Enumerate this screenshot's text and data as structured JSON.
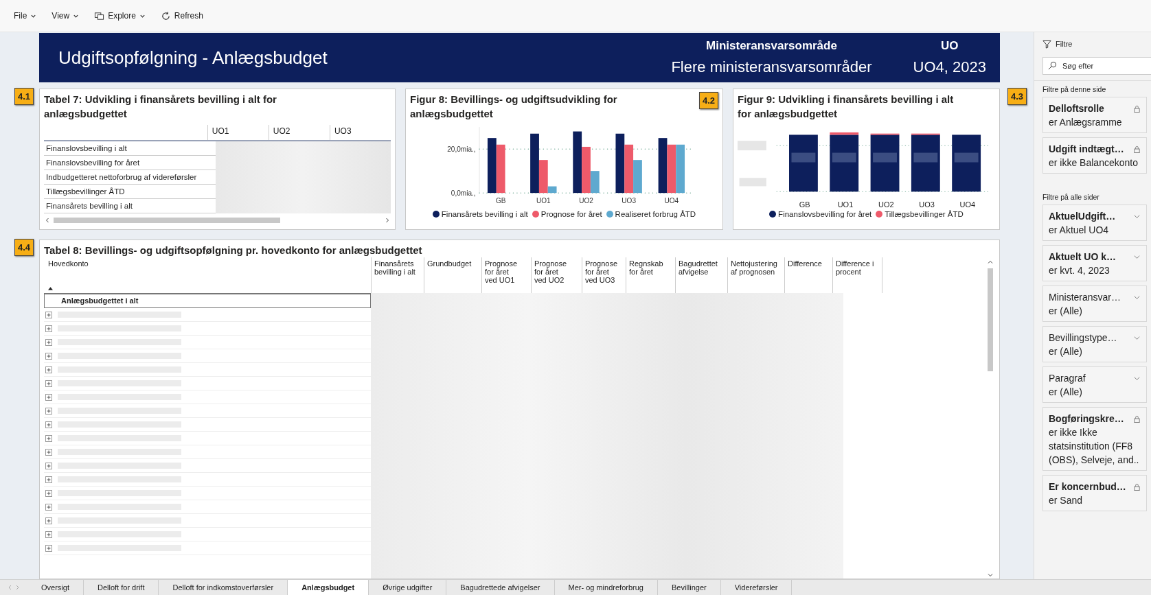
{
  "menu": [
    {
      "label": "File"
    },
    {
      "label": "View"
    },
    {
      "label": "Explore"
    },
    {
      "label": "Refresh"
    }
  ],
  "banner": {
    "title": "Udgiftsopfølgning - Anlægsbudget",
    "field_1_label": "Ministeransvarsområde",
    "field_1_value": "Flere ministeransvarsområder",
    "field_2_label": "UO",
    "field_2_value": "UO4, 2023"
  },
  "tabel7": {
    "badge": "4.1",
    "title": "Tabel 7: Udvikling i finansårets bevilling i alt for anlægsbudgettet",
    "columns": [
      "UO1",
      "UO2",
      "UO3"
    ],
    "rows": [
      "Finanslovsbevilling i alt",
      "Finanslovsbevilling for året",
      "Indbudgetteret nettoforbrug af videreførsler",
      "Tillægsbevillinger ÅTD",
      "Finansårets bevilling i alt"
    ]
  },
  "figur8": {
    "badge": "4.2",
    "title": "Figur 8: Bevillings- og udgiftsudvikling for anlægsbudgettet",
    "chart_data": {
      "type": "bar",
      "categories": [
        "GB",
        "UO1",
        "UO2",
        "UO3",
        "UO4"
      ],
      "ylim": [
        0,
        30
      ],
      "yticks": [
        {
          "value": 0,
          "label": "0,0mia.,"
        },
        {
          "value": 20,
          "label": "20,0mia.,"
        }
      ],
      "series": [
        {
          "name": "Finansårets bevilling i alt",
          "color": "#0d1f5c",
          "values": [
            25,
            27,
            28,
            27,
            25
          ]
        },
        {
          "name": "Prognose for året",
          "color": "#ee5a6a",
          "values": [
            22,
            15,
            21,
            22,
            22
          ]
        },
        {
          "name": "Realiseret forbrug ÅTD",
          "color": "#5ea9cf",
          "values": [
            null,
            3,
            10,
            15,
            22
          ]
        }
      ]
    }
  },
  "figur9": {
    "badge": "4.3",
    "title": "Figur 9: Udvikling i finansårets bevilling i alt for anlægsbudgettet",
    "categories": [
      "GB",
      "UO1",
      "UO2",
      "UO3",
      "UO4"
    ],
    "legend": [
      {
        "name": "Finanslovsbevilling for året",
        "color": "#0d1f5c"
      },
      {
        "name": "Tillægsbevillinger ÅTD",
        "color": "#ee5a6a"
      }
    ]
  },
  "tabel8": {
    "badge": "4.4",
    "title": "Tabel 8: Bevillings- og udgiftsopfølgning pr. hovedkonto for anlægsbudgettet",
    "columns": [
      "Hovedkonto",
      "Finansårets\nbevilling i alt",
      "Grundbudget",
      "Prognose\nfor året\nved UO1",
      "Prognose\nfor året\nved UO2",
      "Prognose\nfor året\nved UO3",
      "Regnskab\nfor året",
      "Bagudrettet\nafvigelse",
      "Nettojustering\naf prognosen",
      "Difference",
      "Difference i\nprocent"
    ],
    "total_row": "Anlægsbudgettet i alt",
    "rows": [
      {
        "expanded": false
      },
      {
        "expanded": false
      },
      {
        "expanded": false
      },
      {
        "expanded": false
      },
      {
        "expanded": false
      },
      {
        "expanded": false
      },
      {
        "expanded": false
      },
      {
        "expanded": false
      },
      {
        "expanded": false
      },
      {
        "expanded": false
      },
      {
        "expanded": false
      },
      {
        "expanded": false
      },
      {
        "expanded": false
      },
      {
        "expanded": false
      },
      {
        "expanded": false
      },
      {
        "expanded": false
      },
      {
        "expanded": false
      },
      {
        "expanded": false
      }
    ]
  },
  "filters": {
    "title": "Filtre",
    "search_placeholder": "Søg efter",
    "sections": [
      {
        "heading": "Filtre på denne side",
        "cards": [
          {
            "title": "Delloftsrolle",
            "value": "er Anlægsramme",
            "applied": true,
            "kind": "locked"
          },
          {
            "title": "Udgift indtægt…",
            "value": "er ikke Balancekonto",
            "applied": true,
            "kind": "locked"
          }
        ]
      },
      {
        "heading": "Filtre på alle sider",
        "cards": [
          {
            "title": "AktuelUdgift…",
            "value": "er Aktuel UO4",
            "applied": true,
            "kind": "dropdown"
          },
          {
            "title": "Aktuelt UO k…",
            "value": "er kvt. 4, 2023",
            "applied": true,
            "kind": "dropdown"
          },
          {
            "title": "Ministeransvar…",
            "value": "er (Alle)",
            "applied": false,
            "kind": "dropdown"
          },
          {
            "title": "Bevillingstype…",
            "value": "er (Alle)",
            "applied": false,
            "kind": "dropdown"
          },
          {
            "title": "Paragraf",
            "value": "er (Alle)",
            "applied": false,
            "kind": "dropdown"
          },
          {
            "title": "Bogføringskre…",
            "value": "er ikke Ikke statsinstitution (FF8 (OBS), Selveje, and..",
            "applied": true,
            "kind": "locked"
          },
          {
            "title": "Er koncernbud…",
            "value": "er Sand",
            "applied": true,
            "kind": "locked"
          }
        ]
      }
    ]
  },
  "pages": [
    {
      "label": "Oversigt",
      "selected": false
    },
    {
      "label": "Delloft for drift",
      "selected": false
    },
    {
      "label": "Delloft for indkomstoverførsler",
      "selected": false
    },
    {
      "label": "Anlægsbudget",
      "selected": true
    },
    {
      "label": "Øvrige udgifter",
      "selected": false
    },
    {
      "label": "Bagudrettede afvigelser",
      "selected": false
    },
    {
      "label": "Mer- og mindreforbrug",
      "selected": false
    },
    {
      "label": "Bevillinger",
      "selected": false
    },
    {
      "label": "Videreførsler",
      "selected": false
    }
  ]
}
